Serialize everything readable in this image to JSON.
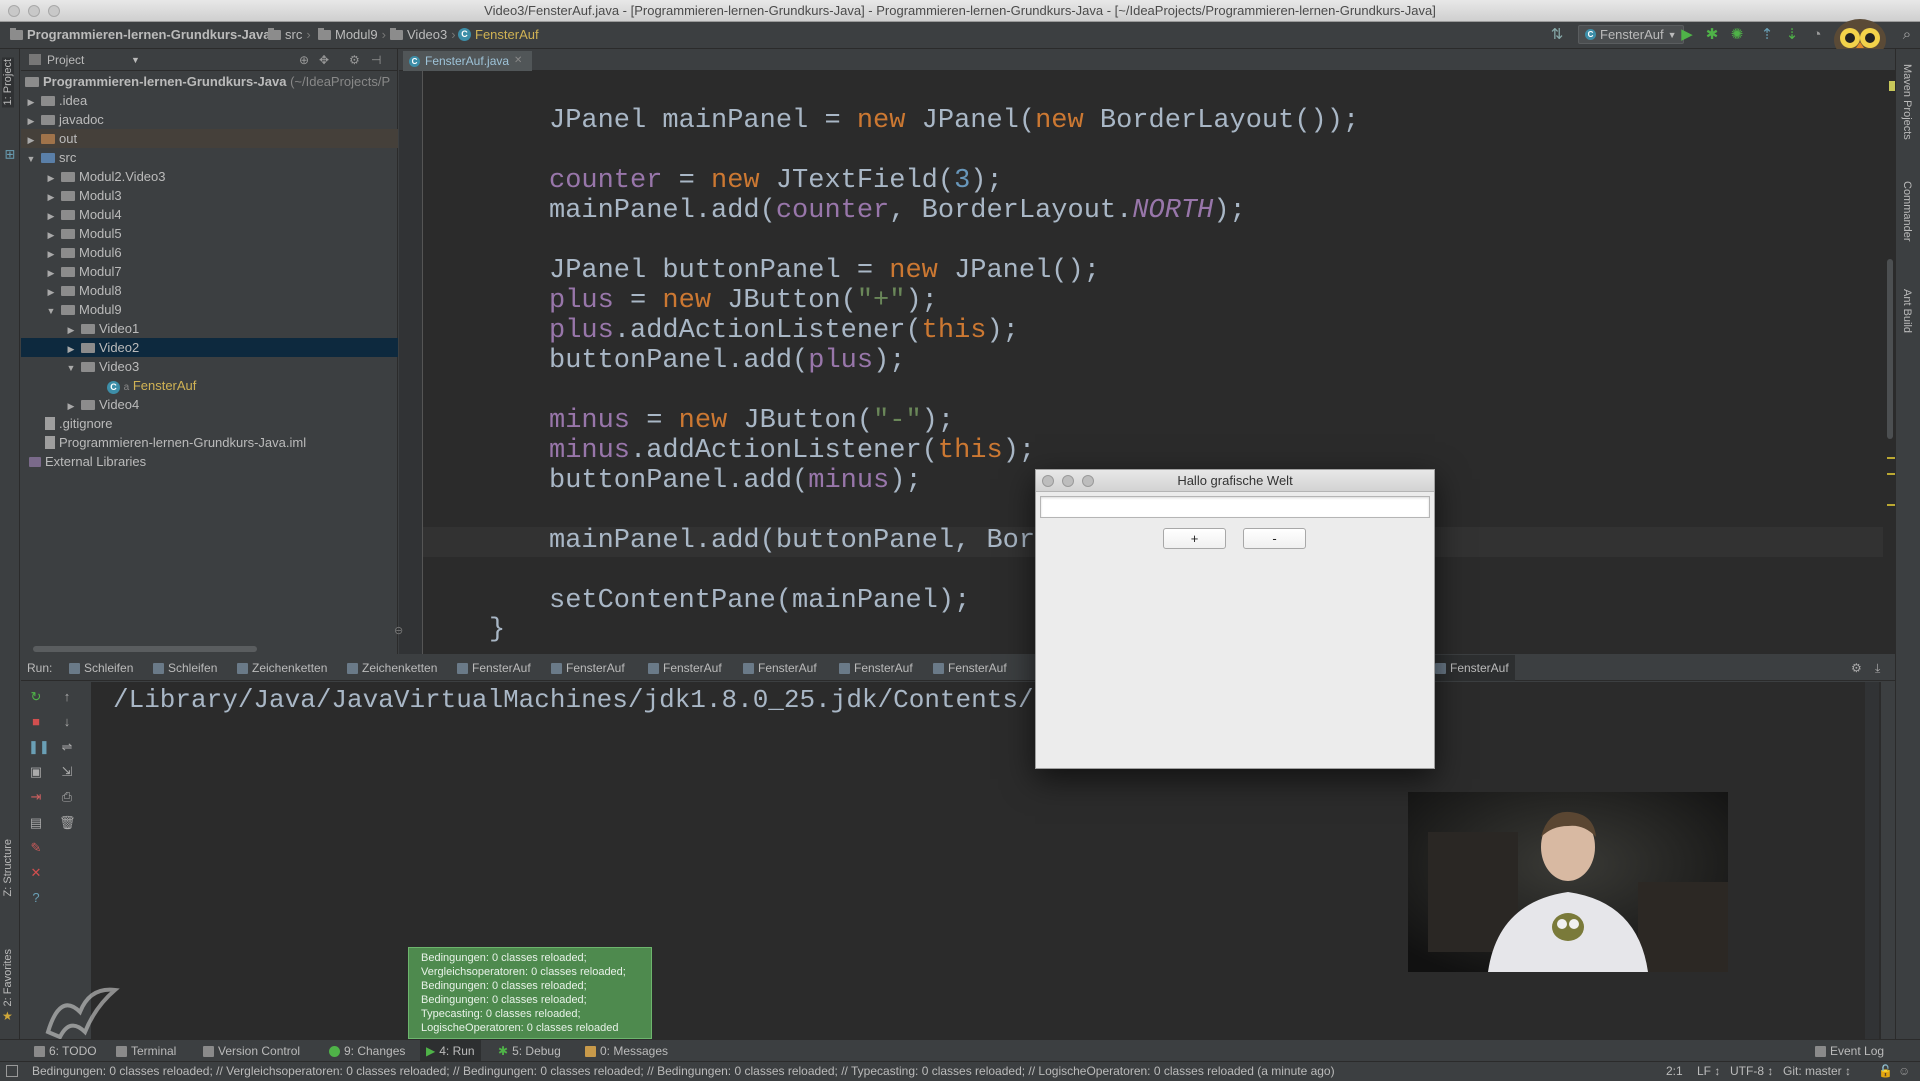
{
  "window": {
    "title": "Video3/FensterAuf.java - [Programmieren-lernen-Grundkurs-Java] - Programmieren-lernen-Grundkurs-Java - [~/IdeaProjects/Programmieren-lernen-Grundkurs-Java]"
  },
  "breadcrumbs": [
    "Programmieren-lernen-Grundkurs-Java",
    "src",
    "Modul9",
    "Video3",
    "FensterAuf"
  ],
  "toolbar": {
    "run_config": "FensterAuf"
  },
  "left_stripe": {
    "project_tab": "1: Project",
    "structure_tab": "Z: Structure",
    "favorites_tab": "2: Favorites"
  },
  "right_stripe": {
    "maven_tab": "Maven Projects",
    "commander_tab": "Commander",
    "ant_tab": "Ant Build"
  },
  "project_panel": {
    "header": "Project",
    "root_name": "Programmieren-lernen-Grundkurs-Java",
    "root_path": "(~/IdeaProjects/P",
    "tree": [
      {
        "label": ".idea"
      },
      {
        "label": "javadoc"
      },
      {
        "label": "out"
      },
      {
        "label": "src"
      },
      {
        "label": "Modul2.Video3"
      },
      {
        "label": "Modul3"
      },
      {
        "label": "Modul4"
      },
      {
        "label": "Modul5"
      },
      {
        "label": "Modul6"
      },
      {
        "label": "Modul7"
      },
      {
        "label": "Modul8"
      },
      {
        "label": "Modul9"
      },
      {
        "label": "Video1"
      },
      {
        "label": "Video2"
      },
      {
        "label": "Video3"
      },
      {
        "label": "FensterAuf"
      },
      {
        "label": "Video4"
      },
      {
        "label": ".gitignore"
      },
      {
        "label": "Programmieren-lernen-Grundkurs-Java.iml"
      },
      {
        "label": "External Libraries"
      }
    ]
  },
  "editor": {
    "tab": "FensterAuf.java",
    "code": {
      "l1": {
        "a": "JPanel mainPanel = ",
        "b": "new",
        "c": " JPanel(",
        "d": "new",
        "e": " BorderLayout());"
      },
      "l2": {
        "a": "counter",
        "b": " = ",
        "c": "new",
        "d": " JTextField(",
        "e": "3",
        "f": ");"
      },
      "l3": {
        "a": "mainPanel.add(",
        "b": "counter",
        "c": ", BorderLayout.",
        "d": "NORTH",
        "e": ");"
      },
      "l4": {
        "a": "JPanel buttonPanel = ",
        "b": "new",
        "c": " JPanel();"
      },
      "l5": {
        "a": "plus",
        "b": " = ",
        "c": "new",
        "d": " JButton(",
        "e": "\"+\"",
        "f": ");"
      },
      "l6": {
        "a": "plus",
        "b": ".addActionListener(",
        "c": "this",
        "d": ");"
      },
      "l7": {
        "a": "buttonPanel.add(",
        "b": "plus",
        "c": ");"
      },
      "l8": {
        "a": "minus",
        "b": " = ",
        "c": "new",
        "d": " JButton(",
        "e": "\"-\"",
        "f": ");"
      },
      "l9": {
        "a": "minus",
        "b": ".addActionListener(",
        "c": "this",
        "d": ");"
      },
      "l10": {
        "a": "buttonPanel.add(",
        "b": "minus",
        "c": ");"
      },
      "l11": {
        "a": "mainPanel.add(buttonPanel, Border"
      },
      "l12": {
        "a": "setContentPane(mainPanel);"
      },
      "l13": {
        "a": "}"
      }
    }
  },
  "run_panel": {
    "label": "Run:",
    "tabs": [
      "Schleifen",
      "Schleifen",
      "Zeichenketten",
      "Zeichenketten",
      "FensterAuf",
      "FensterAuf",
      "FensterAuf",
      "FensterAuf",
      "FensterAuf",
      "FensterAuf",
      "FensterAuf"
    ],
    "console_text": "/Library/Java/JavaVirtualMachines/jdk1.8.0_25.jdk/Contents/Home"
  },
  "dialog": {
    "title": "Hallo grafische Welt",
    "counter_value": "",
    "plus_label": "+",
    "minus_label": "-"
  },
  "balloon": {
    "lines": [
      "Bedingungen: 0 classes reloaded;",
      "Vergleichsoperatoren: 0 classes reloaded;",
      "Bedingungen: 0 classes reloaded;",
      "Bedingungen: 0 classes reloaded;",
      "Typecasting: 0 classes reloaded;",
      "LogischeOperatoren: 0 classes reloaded"
    ]
  },
  "bottom_bar": {
    "todo": "6: TODO",
    "terminal": "Terminal",
    "vcs": "Version Control",
    "changes": "9: Changes",
    "run": "4: Run",
    "debug": "5: Debug",
    "messages": "0: Messages",
    "event_log": "Event Log"
  },
  "status_bar": {
    "message": "Bedingungen: 0 classes reloaded; // Vergleichsoperatoren: 0 classes reloaded; // Bedingungen: 0 classes reloaded; // Bedingungen: 0 classes reloaded; // Typecasting: 0 classes reloaded; // LogischeOperatoren: 0 classes reloaded (a minute ago)",
    "position": "2:1",
    "line_sep": "LF ↕",
    "encoding": "UTF-8 ↕",
    "git": "Git: master ↕"
  },
  "colors": {
    "keyword": "#cc7832",
    "number": "#6897bb",
    "string": "#6a8759",
    "field": "#9876aa",
    "editor_bg": "#2b2b2b",
    "panel_bg": "#3c3f41",
    "selection": "#0d293e",
    "balloon": "#4e8a4e"
  }
}
